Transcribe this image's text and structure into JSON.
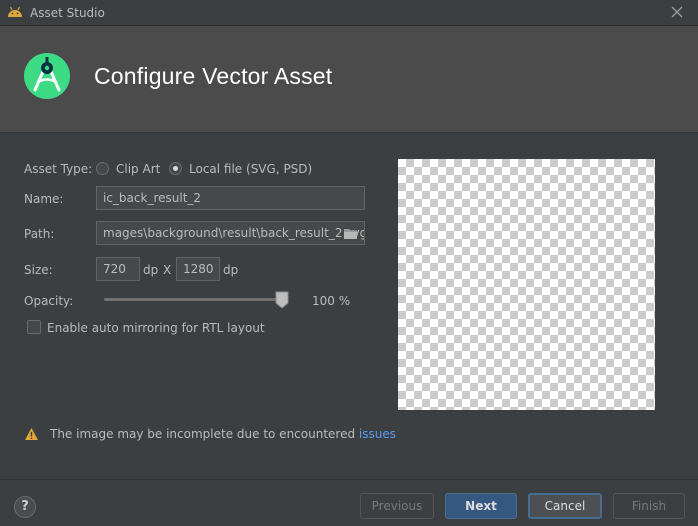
{
  "window": {
    "title": "Asset Studio"
  },
  "header": {
    "title": "Configure Vector Asset"
  },
  "form": {
    "asset_type_label": "Asset Type:",
    "asset_type_options": [
      "Clip Art",
      "Local file (SVG, PSD)"
    ],
    "asset_type_selected": "Local file (SVG, PSD)",
    "name_label": "Name:",
    "name_value": "ic_back_result_2",
    "path_label": "Path:",
    "path_value": "mages\\background\\result\\back_result_2.svg",
    "size_label": "Size:",
    "width_value": "720",
    "height_value": "1280",
    "unit_dp": "dp",
    "separator_x": "X",
    "opacity_label": "Opacity:",
    "opacity_value": "100 %",
    "opacity_level": 1.0,
    "rtl_label": "Enable auto mirroring for RTL layout",
    "rtl_checked": false
  },
  "warning": {
    "text": "The image may be incomplete due to encountered ",
    "link": "issues"
  },
  "footer": {
    "help_label": "?",
    "previous_label": "Previous",
    "next_label": "Next",
    "cancel_label": "Cancel",
    "finish_label": "Finish"
  },
  "colors": {
    "background": "#3c3f41",
    "header_background": "#4b4b4b",
    "primary_button": "#365880",
    "link": "#589df6",
    "warning": "#e0a73a",
    "android_green": "#3ddc84"
  }
}
